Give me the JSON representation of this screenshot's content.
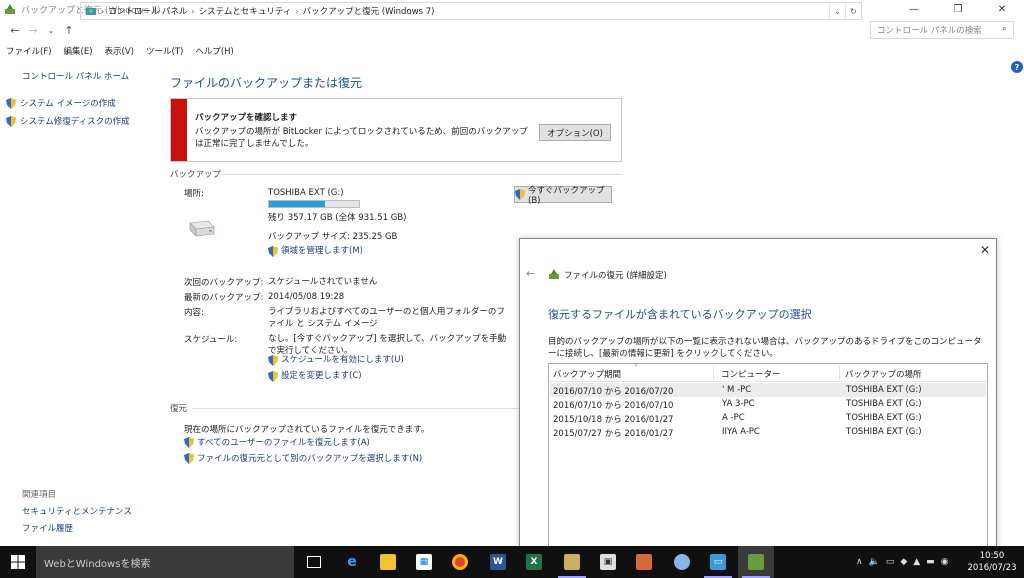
{
  "window": {
    "title": "バックアップと復元 (Windows 7)",
    "minimize": "—",
    "restore": "❐",
    "close": "✕"
  },
  "address": {
    "crumbs": [
      "コントロール パネル",
      "システムとセキュリティ",
      "バックアップと復元 (Windows 7)"
    ],
    "search_placeholder": "コントロール パネルの検索"
  },
  "menu": {
    "items": [
      "ファイル(F)",
      "編集(E)",
      "表示(V)",
      "ツール(T)",
      "ヘルプ(H)"
    ]
  },
  "sidebar": {
    "home": "コントロール パネル ホーム",
    "tasks": [
      "システム イメージの作成",
      "システム修復ディスクの作成"
    ],
    "related_title": "関連項目",
    "related": [
      "セキュリティとメンテナンス",
      "ファイル履歴"
    ]
  },
  "main": {
    "title": "ファイルのバックアップまたは復元",
    "warning": {
      "title": "バックアップを確認します",
      "text": "バックアップの場所が BitLocker によってロックされているため、前回のバックアップは正常に完了しませんでした。",
      "button": "オプション(O)"
    },
    "backup": {
      "section": "バックアップ",
      "location_label": "場所:",
      "location_value": "TOSHIBA EXT (G:)",
      "free_text": "残り 357.17 GB (全体 931.51 GB)",
      "used_fraction": 0.62,
      "size_text": "バックアップ サイズ: 235.25 GB",
      "manage_link": "領域を管理します(M)",
      "backup_now": "今すぐバックアップ(B)",
      "next_label": "次回のバックアップ:",
      "next_value": "スケジュールされていません",
      "last_label": "最新のバックアップ:",
      "last_value": "2014/05/08 19:28",
      "contents_label": "内容:",
      "contents_value": "ライブラリおよびすべてのユーザーのと個人用フォルダーのファイル と システム イメージ",
      "schedule_label": "スケジュール:",
      "schedule_value": "なし。[今すぐバックアップ] を選択して、バックアップを手動で実行してください。",
      "enable_schedule": "スケジュールを有効にします(U)",
      "change_settings": "設定を変更します(C)"
    },
    "restore": {
      "section": "復元",
      "text": "現在の場所にバックアップされているファイルを復元できます。",
      "restore_all": "すべてのユーザーのファイルを復元します(A)",
      "select_other": "ファイルの復元元として別のバックアップを選択します(N)"
    }
  },
  "dialog": {
    "title": "ファイルの復元 (詳細設定)",
    "heading": "復元するファイルが含まれているバックアップの選択",
    "description": "目的のバックアップの場所が以下の一覧に表示されない場合は、バックアップのあるドライブをこのコンピューターに接続し、[最新の情報に更新] をクリックしてください。",
    "columns": [
      "バックアップ期間",
      "コンピューター",
      "バックアップの場所"
    ],
    "rows": [
      {
        "period": "2016/07/10 から 2016/07/20",
        "computer": "' M -PC",
        "location": "TOSHIBA EXT (G:)"
      },
      {
        "period": "2016/07/10 から 2016/07/10",
        "computer": "YA 3-PC",
        "location": "TOSHIBA EXT (G:)"
      },
      {
        "period": "2015/10/18 から 2016/01/27",
        "computer": "A -PC",
        "location": "TOSHIBA EXT (G:)"
      },
      {
        "period": "2015/07/27 から 2016/01/27",
        "computer": "IIYA A-PC",
        "location": "TOSHIBA EXT (G:)"
      }
    ]
  },
  "taskbar": {
    "search": "WebとWindowsを検索",
    "time": "10:50",
    "date": "2016/07/23"
  }
}
